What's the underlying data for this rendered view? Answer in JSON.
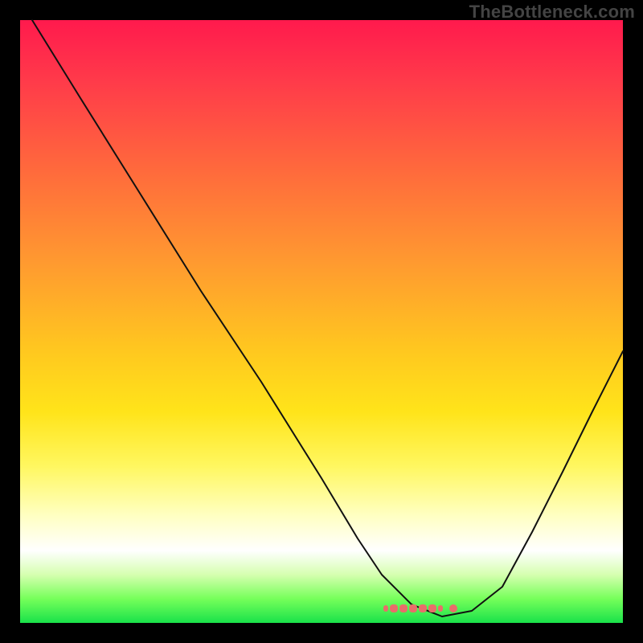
{
  "watermark": "TheBottleneck.com",
  "chart_data": {
    "type": "line",
    "title": "",
    "xlabel": "",
    "ylabel": "",
    "xlim": [
      0,
      100
    ],
    "ylim": [
      0,
      100
    ],
    "grid": false,
    "legend": false,
    "series": [
      {
        "name": "bottleneck-curve",
        "x": [
          2,
          10,
          20,
          30,
          40,
          50,
          56,
          60,
          65,
          70,
          75,
          80,
          85,
          90,
          95,
          100
        ],
        "y": [
          100,
          87,
          71,
          55,
          40,
          24,
          14,
          8,
          3,
          1,
          2,
          6,
          15,
          25,
          35,
          45
        ]
      }
    ],
    "annotations": [
      {
        "name": "optimal-marker",
        "x_start": 62,
        "x_end": 75,
        "y": 1
      }
    ],
    "colors": {
      "curve": "#111111",
      "marker": "#e96d6a",
      "gradient_top": "#ff1a4d",
      "gradient_mid": "#ffe41a",
      "gradient_bottom": "#19e24a"
    }
  }
}
